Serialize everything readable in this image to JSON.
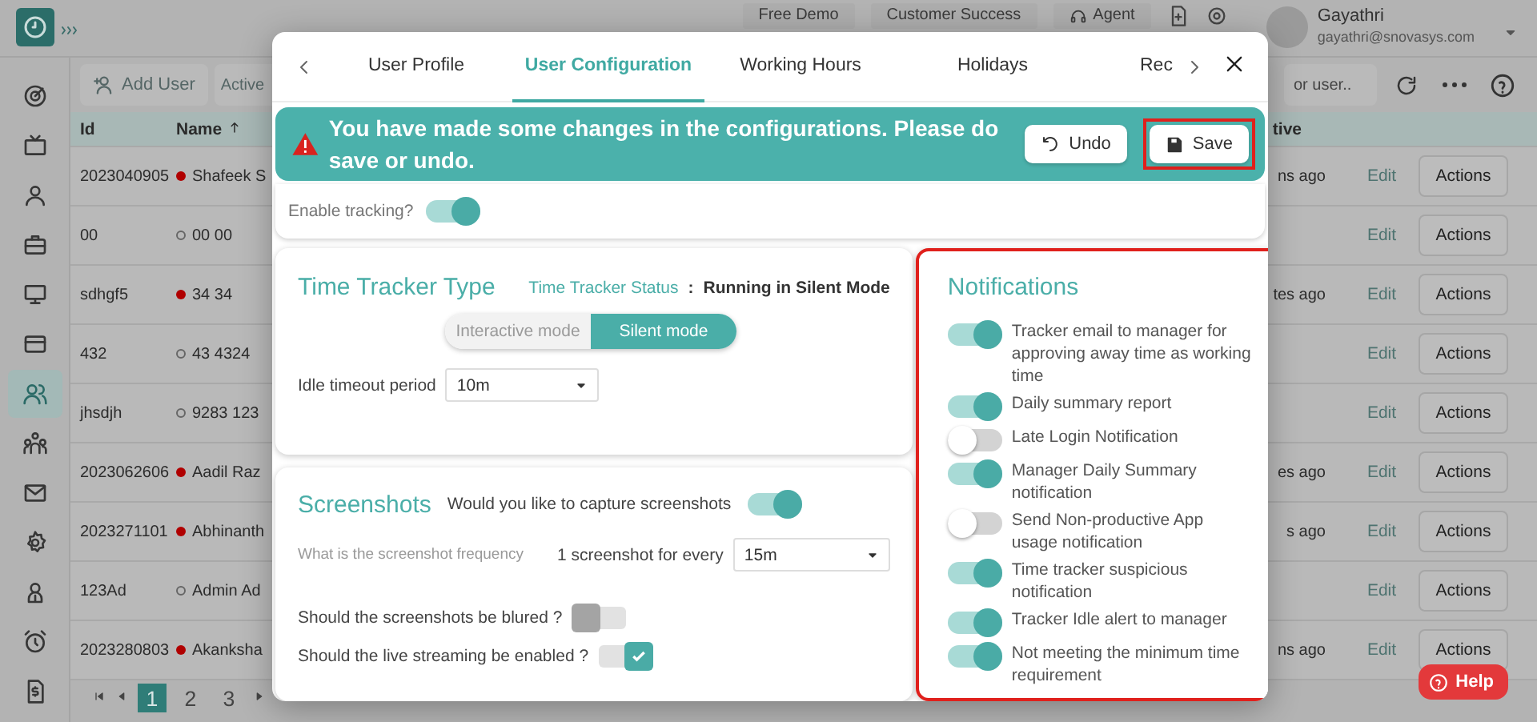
{
  "top_bar": {
    "buttons": [
      {
        "label": "Free Demo"
      },
      {
        "label": "Customer Success"
      },
      {
        "label": "Agent"
      }
    ],
    "user": {
      "name": "Gayathri",
      "email": "gayathri@snovasys.com"
    }
  },
  "sidebar": {
    "items": [
      {
        "selected": false
      },
      {
        "selected": false
      },
      {
        "selected": false
      },
      {
        "selected": false
      },
      {
        "selected": false
      },
      {
        "selected": false
      },
      {
        "selected": true
      },
      {
        "selected": false
      },
      {
        "selected": false
      },
      {
        "selected": false
      },
      {
        "selected": false
      },
      {
        "selected": false
      },
      {
        "selected": false
      }
    ]
  },
  "toolbar": {
    "add_button": "Add User",
    "filter_button": "Active",
    "search": {
      "placeholder": "or user.."
    }
  },
  "table": {
    "columns": [
      "Id",
      "Name",
      "tive"
    ],
    "rows": [
      {
        "id": "2023040905",
        "name": "Shafeek S",
        "active": true,
        "column_3": "ns ago",
        "edit": "Edit",
        "action": "Actions"
      },
      {
        "id": "00",
        "name": "00 00",
        "active": false,
        "edit": "Edit",
        "action": "Actions"
      },
      {
        "id": "sdhgf5",
        "name": "34 34",
        "active": true,
        "column_3": "tes ago",
        "edit": "Edit",
        "action": "Actions"
      },
      {
        "id": "432",
        "name": "43 4324",
        "active": false,
        "edit": "Edit",
        "action": "Actions"
      },
      {
        "id": "jhsdjh",
        "name": "9283 123",
        "active": false,
        "edit": "Edit",
        "action": "Actions"
      },
      {
        "id": "2023062606",
        "name": "Aadil Raz",
        "active": true,
        "column_3": "es ago",
        "edit": "Edit",
        "action": "Actions"
      },
      {
        "id": "2023271101",
        "name": "Abhinanth",
        "active": true,
        "column_3": "s ago",
        "edit": "Edit",
        "action": "Actions"
      },
      {
        "id": "123Ad",
        "name": "Admin Ad",
        "active": false,
        "edit": "Edit",
        "action": "Actions"
      },
      {
        "id": "2023280803",
        "name": "Akanksha",
        "active": true,
        "column_3": "ns ago",
        "edit": "Edit",
        "action": "Actions"
      }
    ]
  },
  "pagination": {
    "pages": [
      {
        "label": "1",
        "selected": true
      },
      {
        "label": "2",
        "selected": false
      },
      {
        "label": "3",
        "selected": false
      }
    ]
  },
  "modal": {
    "tabs": [
      {
        "label": "User Profile",
        "selected": false
      },
      {
        "label": "User Configuration",
        "selected": true
      },
      {
        "label": "Working Hours",
        "selected": false
      },
      {
        "label": "Holidays",
        "selected": false
      },
      {
        "label": "Rec",
        "selected": false
      }
    ],
    "alert": {
      "message": "You have made some changes in the configurations. Please do save or undo.",
      "buttons": [
        {
          "label": "Undo",
          "kind": "undo",
          "highlighted": false
        },
        {
          "label": "Save",
          "kind": "save",
          "highlighted": true
        }
      ]
    },
    "enable_tracking": {
      "label": "Enable tracking?",
      "on": true
    },
    "time_tracker": {
      "title": "Time Tracker Type",
      "status_label": "Time Tracker Status",
      "separator": ":",
      "status_value": "Running in Silent Mode",
      "modes": [
        {
          "label": "Interactive mode",
          "selected": false
        },
        {
          "label": "Silent mode",
          "selected": true
        }
      ],
      "idle_label": "Idle timeout period",
      "idle_value": "10m"
    },
    "screenshots": {
      "title": "Screenshots",
      "capture_label": "Would you like to capture screenshots",
      "capture_on": true,
      "frequency_label": "What is the screenshot frequency",
      "frequency_prefix": "1 screenshot for every",
      "frequency_value": "15m",
      "options": [
        {
          "label": "Should the screenshots be blured ?",
          "on": false
        },
        {
          "label": "Should the live streaming be enabled ?",
          "on": true
        }
      ]
    },
    "notifications": {
      "title": "Notifications",
      "highlighted": true,
      "items": [
        {
          "label": "Tracker email to manager for approving away time as working time",
          "on": true
        },
        {
          "label": "Daily summary report",
          "on": true
        },
        {
          "label": "Late Login Notification",
          "on": false
        },
        {
          "label": "Manager Daily Summary notification",
          "on": true
        },
        {
          "label": "Send Non-productive App usage notification",
          "on": false
        },
        {
          "label": "Time tracker suspicious notification",
          "on": true
        },
        {
          "label": "Tracker Idle alert to manager",
          "on": true
        },
        {
          "label": "Not meeting the minimum time requirement",
          "on": true
        }
      ]
    }
  },
  "help": {
    "label": "Help"
  }
}
